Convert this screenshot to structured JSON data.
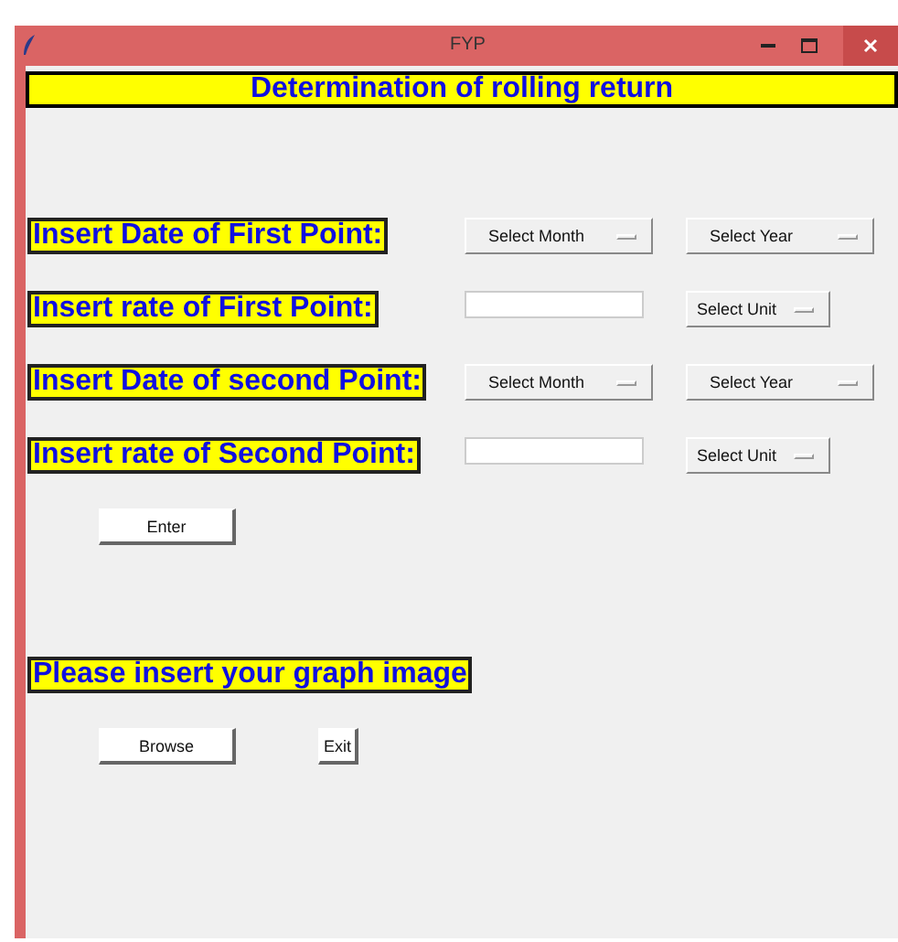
{
  "window": {
    "title": "FYP"
  },
  "header": "Determination of rolling return",
  "rows": [
    {
      "kind": "date",
      "label": "Insert Date of First Point:",
      "month": "Select Month",
      "year": "Select Year"
    },
    {
      "kind": "rate",
      "label": "Insert rate of First Point:",
      "unit": "Select Unit"
    },
    {
      "kind": "date",
      "label": "Insert Date of second Point:",
      "month": "Select Month",
      "year": "Select Year"
    },
    {
      "kind": "rate",
      "label": "Insert rate of Second Point:",
      "unit": "Select Unit"
    }
  ],
  "enter_button": "Enter",
  "graph_label": "Please insert your graph image",
  "browse_button": "Browse",
  "exit_button": "Exit"
}
